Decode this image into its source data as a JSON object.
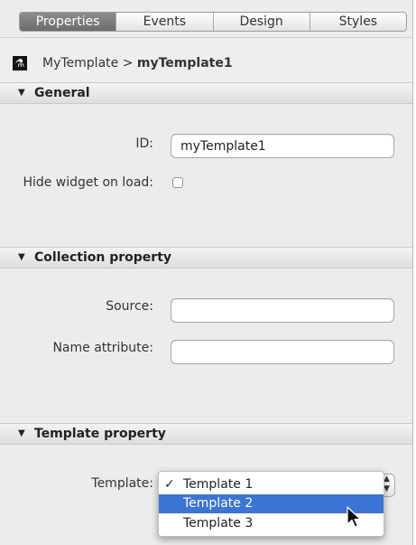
{
  "tabs": [
    {
      "label": "Properties",
      "active": true
    },
    {
      "label": "Events",
      "active": false
    },
    {
      "label": "Design",
      "active": false
    },
    {
      "label": "Styles",
      "active": false
    }
  ],
  "breadcrumb": {
    "parent": "MyTemplate",
    "separator": ">",
    "current": "myTemplate1"
  },
  "sections": {
    "general": {
      "title": "General",
      "id_label": "ID:",
      "id_value": "myTemplate1",
      "hide_label": "Hide widget on load:",
      "hide_checked": false
    },
    "collection": {
      "title": "Collection property",
      "source_label": "Source:",
      "source_value": "",
      "name_attr_label": "Name attribute:",
      "name_attr_value": ""
    },
    "template": {
      "title": "Template property",
      "template_label": "Template:",
      "options": [
        {
          "label": "Template 1",
          "checked": true
        },
        {
          "label": "Template 2",
          "highlighted": true
        },
        {
          "label": "Template 3"
        }
      ]
    }
  },
  "colors": {
    "highlight": "#3c74d6",
    "active_tab": "#7a7a7a"
  },
  "icons": {
    "breadcrumb": "flask-icon",
    "section_toggle": "disclosure-triangle-icon"
  }
}
